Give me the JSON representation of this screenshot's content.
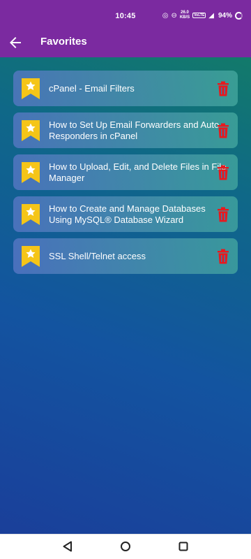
{
  "status_bar": {
    "time": "10:45",
    "net_speed_value": "26.0",
    "net_speed_unit": "KB/S",
    "sim_badge": "VoLTE",
    "battery": "94%"
  },
  "app_bar": {
    "title": "Favorites",
    "back_icon": "arrow-back-icon"
  },
  "favorites": [
    {
      "title": "cPanel - Email Filters"
    },
    {
      "title": "How to Set Up Email Forwarders and Auto Responders in cPanel"
    },
    {
      "title": "How to Upload, Edit, and Delete Files in File Manager"
    },
    {
      "title": "How to Create and Manage Databases Using MySQL® Database Wizard"
    },
    {
      "title": "SSL Shell/Telnet access"
    }
  ],
  "colors": {
    "app_bar": "#7b2aa0",
    "bookmark": "#f5c518",
    "delete": "#e8191e"
  },
  "nav_bar": {
    "back_icon": "triangle-back-icon",
    "home_icon": "circle-home-icon",
    "recents_icon": "square-recents-icon"
  }
}
